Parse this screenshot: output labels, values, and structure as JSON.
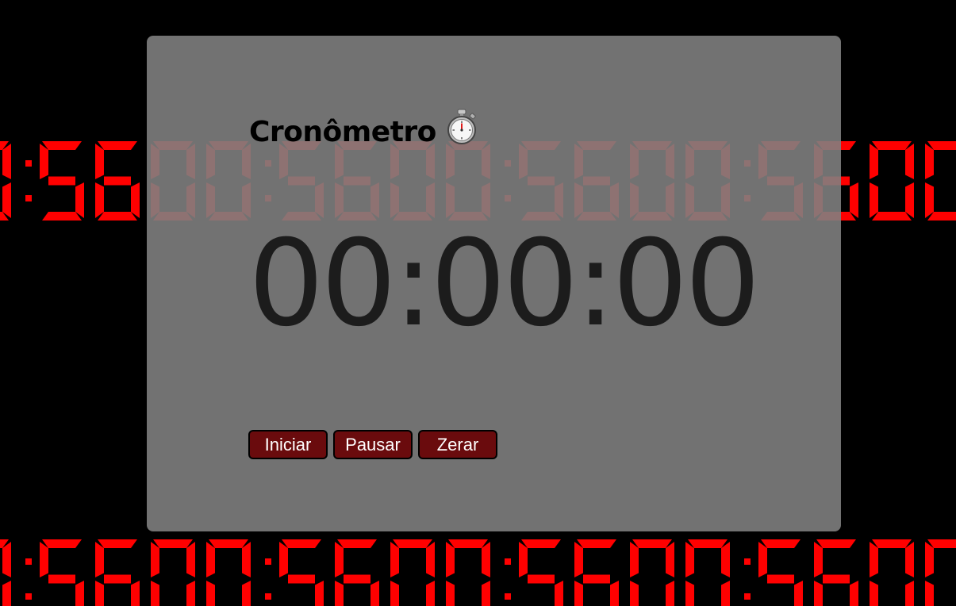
{
  "background": {
    "digit_color": "#ff0000",
    "glow_color": "#ff5c5c"
  },
  "panel": {
    "title": "Cronômetro",
    "icon": "stopwatch-icon",
    "time_display": "00:00:00"
  },
  "controls": {
    "start_label": "Iniciar",
    "pause_label": "Pausar",
    "reset_label": "Zerar",
    "button_color": "#6a0b0d"
  }
}
